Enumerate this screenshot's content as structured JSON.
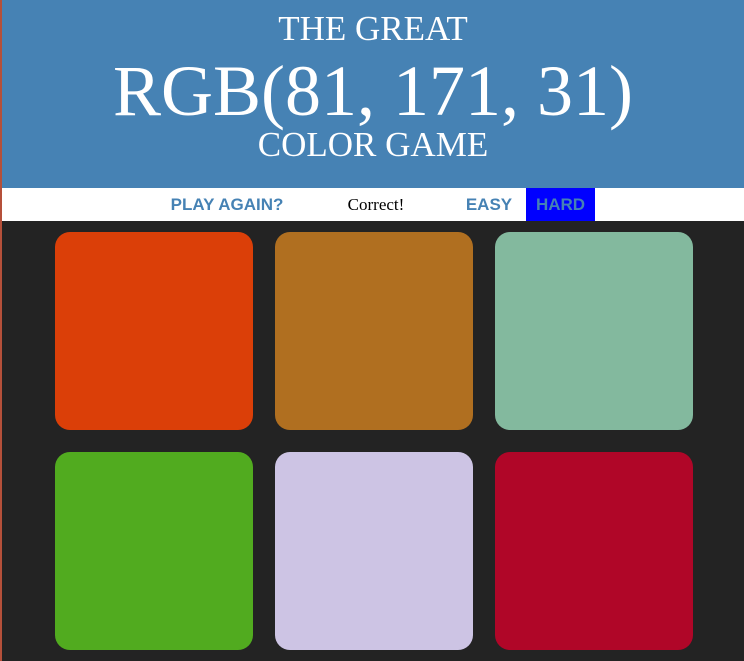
{
  "header": {
    "line1": "THE GREAT",
    "rgb_display": "RGB(81, 171, 31)",
    "line3": "COLOR GAME",
    "background": "#4682b4"
  },
  "controls": {
    "play_again_label": "PLAY AGAIN?",
    "message": "Correct!",
    "easy_label": "EASY",
    "hard_label": "HARD",
    "selected_mode": "HARD",
    "selected_background": "#0000ff",
    "label_color": "#4682b4"
  },
  "board": {
    "background": "#232323",
    "squares": [
      {
        "color": "#db3f08"
      },
      {
        "color": "#b06f20"
      },
      {
        "color": "#83b99e"
      },
      {
        "color": "#51ab1f"
      },
      {
        "color": "#cdc4e4"
      },
      {
        "color": "#b00628"
      }
    ]
  }
}
